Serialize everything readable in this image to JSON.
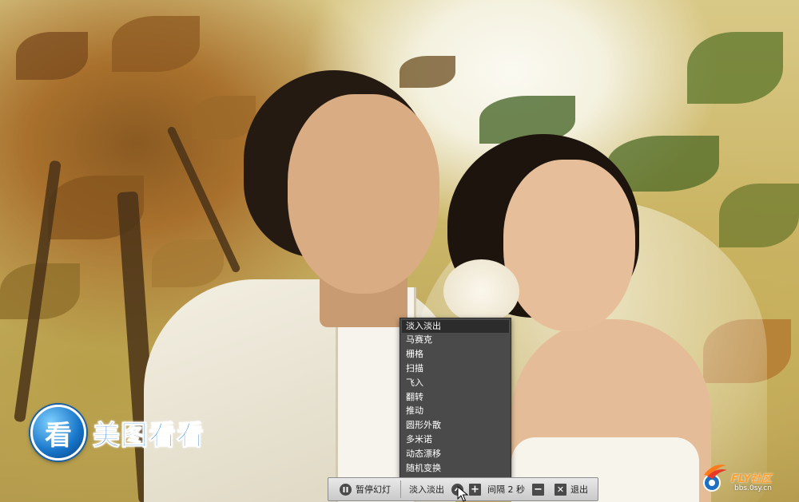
{
  "app": {
    "name": "美图看看",
    "logo_glyph": "看"
  },
  "watermark": {
    "title": "FLY社区",
    "url": "bbs.0sy.cn"
  },
  "transition_menu": {
    "selected": "淡入淡出",
    "items": [
      {
        "label": "淡入淡出"
      },
      {
        "label": "马赛克"
      },
      {
        "label": "栅格"
      },
      {
        "label": "扫描"
      },
      {
        "label": "飞入"
      },
      {
        "label": "翻转"
      },
      {
        "label": "推动"
      },
      {
        "label": "圆形外散"
      },
      {
        "label": "多米诺"
      },
      {
        "label": "动态漂移"
      },
      {
        "label": "随机变换"
      }
    ]
  },
  "control_bar": {
    "pause_label": "暂停幻灯",
    "transition_value": "淡入淡出",
    "interval_label": "间隔 2 秒",
    "exit_label": "退出",
    "icons": {
      "pause": "pause-icon",
      "dropdown": "chevron-up-icon",
      "increase": "plus-icon",
      "decrease": "minus-icon",
      "exit": "close-icon"
    }
  },
  "colors": {
    "logo_blue": "#1a78d6",
    "menu_bg": "#4a4a4a",
    "menu_selected_bg": "#2c2c2c",
    "bar_bg": "#dcdcdc",
    "watermark_orange": "#ff9f2e"
  }
}
